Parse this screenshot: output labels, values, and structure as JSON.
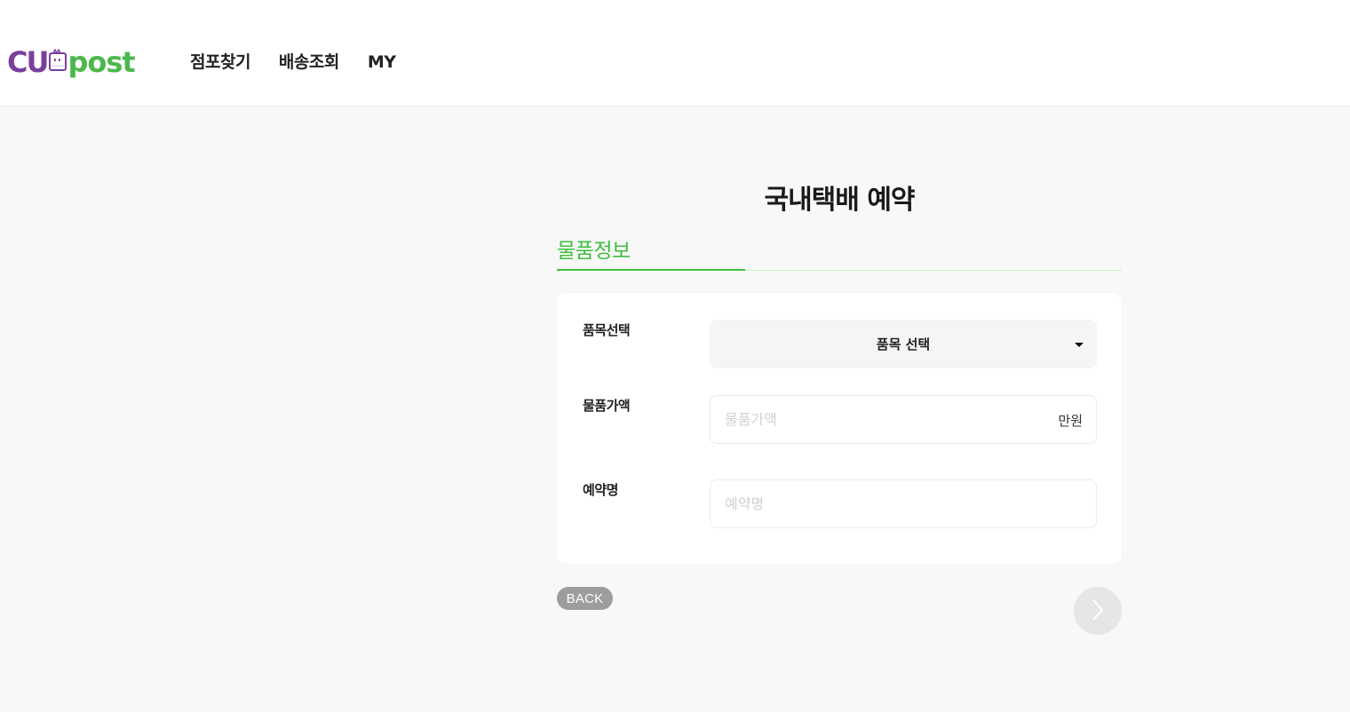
{
  "header": {
    "logo": {
      "text_left": "CU",
      "text_right": "post",
      "colors": {
        "cu": "#7a3f9d",
        "post": "#4cb84c"
      }
    },
    "nav": [
      {
        "label": "점포찾기"
      },
      {
        "label": "배송조회"
      },
      {
        "label": "MY"
      }
    ]
  },
  "main": {
    "title": "국내택배 예약",
    "section": {
      "title": "물품정보",
      "accent_color": "#3cc03c",
      "step_progress": 0.3333
    },
    "form": {
      "item_type": {
        "label": "품목선택",
        "selected": "품목 선택"
      },
      "item_value": {
        "label": "물품가액",
        "placeholder": "물품가액",
        "value": "",
        "unit": "만원"
      },
      "reservation_name": {
        "label": "예약명",
        "placeholder": "예약명",
        "value": ""
      }
    },
    "buttons": {
      "back_label": "BACK",
      "next_icon": "chevron-right-icon"
    }
  }
}
